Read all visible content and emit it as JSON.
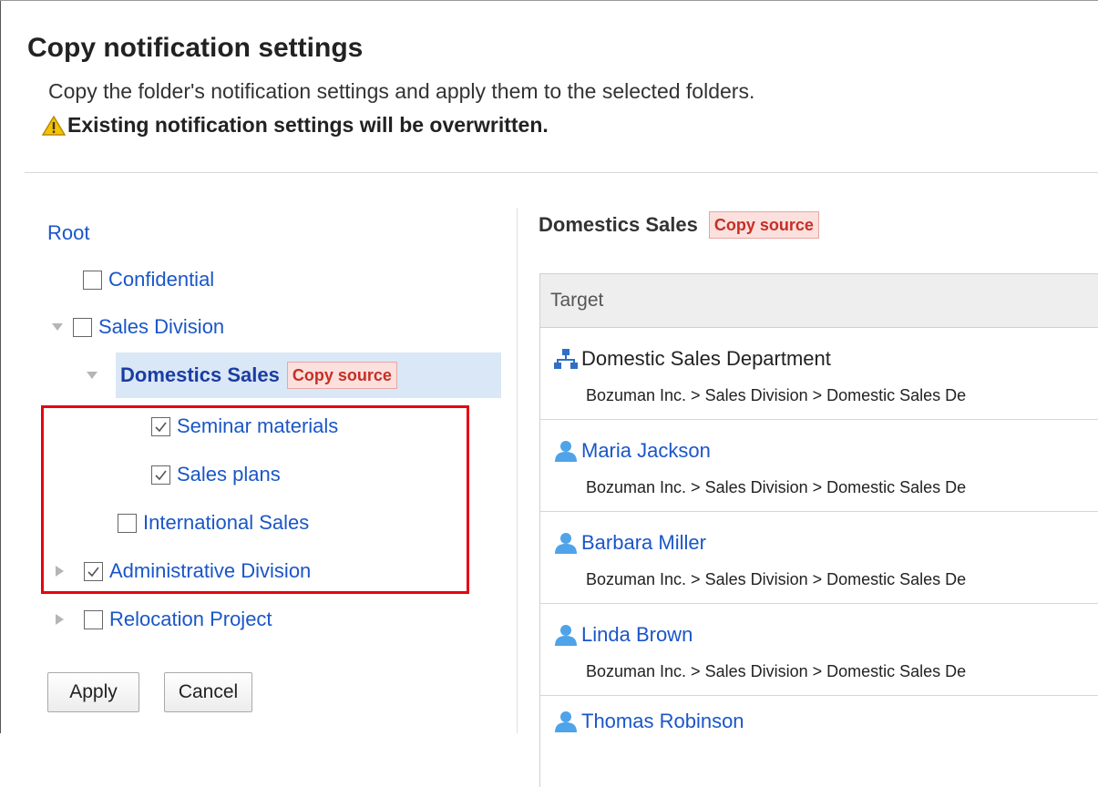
{
  "header": {
    "title": "Copy notification settings",
    "description": "Copy the folder's notification settings and apply them to the selected folders.",
    "warning": "Existing notification settings will be overwritten."
  },
  "tree": {
    "root_label": "Root",
    "nodes": [
      {
        "label": "Confidential",
        "checked": false,
        "expander": "none"
      },
      {
        "label": "Sales Division",
        "checked": false,
        "expander": "expanded"
      },
      {
        "label": "Domestics Sales",
        "current": true,
        "badge": "Copy source",
        "expander": "expanded"
      },
      {
        "label": "Seminar materials",
        "checked": true,
        "expander": "none"
      },
      {
        "label": "Sales plans",
        "checked": true,
        "expander": "none"
      },
      {
        "label": "International Sales",
        "checked": false,
        "expander": "none"
      },
      {
        "label": "Administrative Division",
        "checked": true,
        "expander": "collapsed"
      },
      {
        "label": "Relocation Project",
        "checked": false,
        "expander": "collapsed"
      }
    ]
  },
  "buttons": {
    "apply": "Apply",
    "cancel": "Cancel"
  },
  "detail": {
    "folder_name": "Domestics Sales",
    "badge": "Copy source",
    "column_header": "Target",
    "targets": [
      {
        "type": "organization",
        "name": "Domestic Sales Department",
        "path": "Bozuman Inc. > Sales Division > Domestic Sales De"
      },
      {
        "type": "user",
        "name": "Maria Jackson",
        "path": "Bozuman Inc. > Sales Division > Domestic Sales De"
      },
      {
        "type": "user",
        "name": "Barbara Miller",
        "path": "Bozuman Inc. > Sales Division > Domestic Sales De"
      },
      {
        "type": "user",
        "name": "Linda Brown",
        "path": "Bozuman Inc. > Sales Division > Domestic Sales De"
      },
      {
        "type": "user",
        "name": "Thomas Robinson",
        "path": ""
      }
    ]
  },
  "icons": {
    "warning": "warning-icon",
    "organization": "organization-icon",
    "user": "user-icon",
    "expanded": "triangle-down-icon",
    "collapsed": "triangle-right-icon"
  },
  "colors": {
    "link": "#1a56c8",
    "current_folder": "#1a3da3",
    "badge_bg": "#fbe0de",
    "badge_text": "#c62f24",
    "selected_row": "#dae7f6",
    "highlight_border": "#e60012",
    "user_icon": "#4fa3e8",
    "org_icon": "#2f6fc5"
  }
}
